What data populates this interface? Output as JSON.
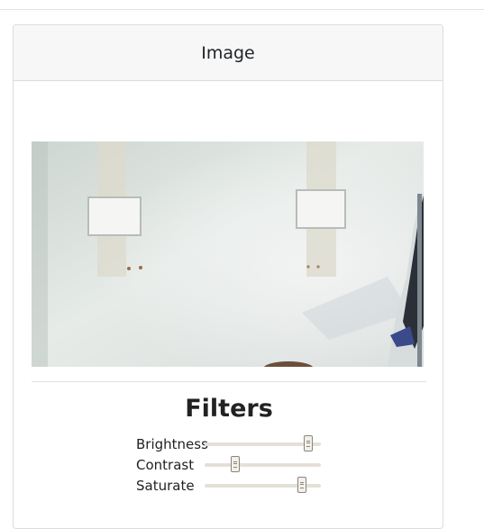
{
  "card": {
    "title": "Image"
  },
  "filters": {
    "title": "Filters",
    "items": [
      {
        "label": "Brightness",
        "value": 0.89
      },
      {
        "label": "Contrast",
        "value": 0.26
      },
      {
        "label": "Saturate",
        "value": 0.84
      }
    ]
  }
}
